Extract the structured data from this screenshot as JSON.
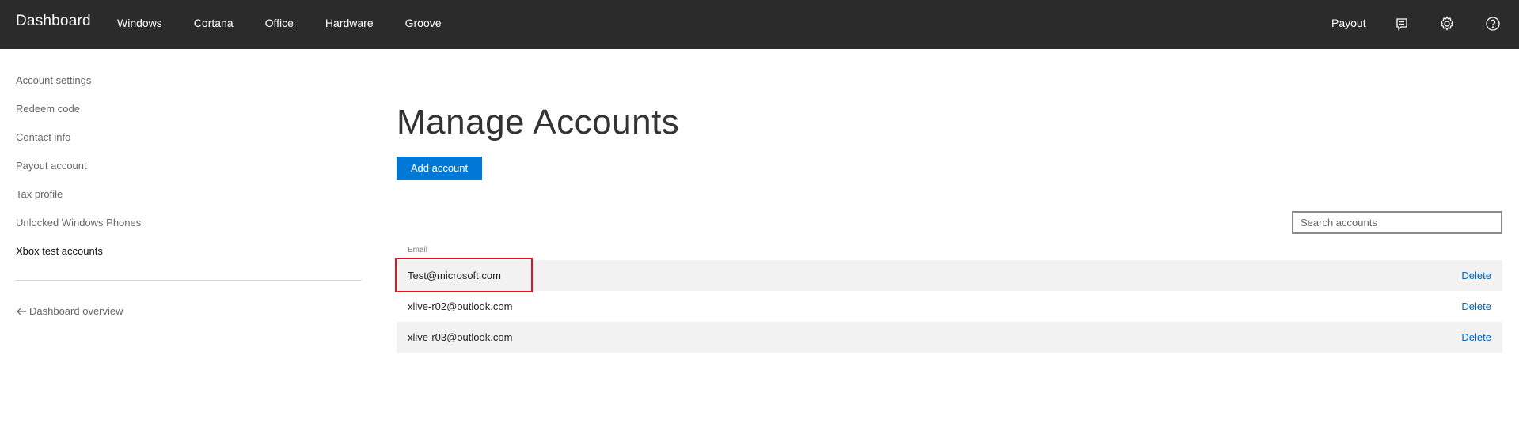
{
  "header": {
    "brand": "Dashboard",
    "nav": [
      "Windows",
      "Cortana",
      "Office",
      "Hardware",
      "Groove"
    ],
    "payout_label": "Payout",
    "icons": [
      "feedback-icon",
      "gear-icon",
      "help-icon"
    ],
    "background": "#2b2b2b"
  },
  "sidebar": {
    "items": [
      "Account settings",
      "Redeem code",
      "Contact info",
      "Payout account",
      "Tax profile",
      "Unlocked Windows Phones",
      "Xbox test accounts"
    ],
    "active": "Xbox test accounts",
    "back_label": "Dashboard overview"
  },
  "main": {
    "title": "Manage Accounts",
    "add_button": "Add account",
    "search_placeholder": "Search accounts",
    "column_header": "Email",
    "delete_label": "Delete",
    "accounts": [
      "Test@microsoft.com",
      "xlive-r02@outlook.com",
      "xlive-r03@outlook.com"
    ],
    "highlighted_account": "Test@microsoft.com"
  },
  "colors": {
    "accent": "#0078d7",
    "link": "#0067b8",
    "highlight": "#e81123",
    "row_shade": "#f2f2f2"
  }
}
